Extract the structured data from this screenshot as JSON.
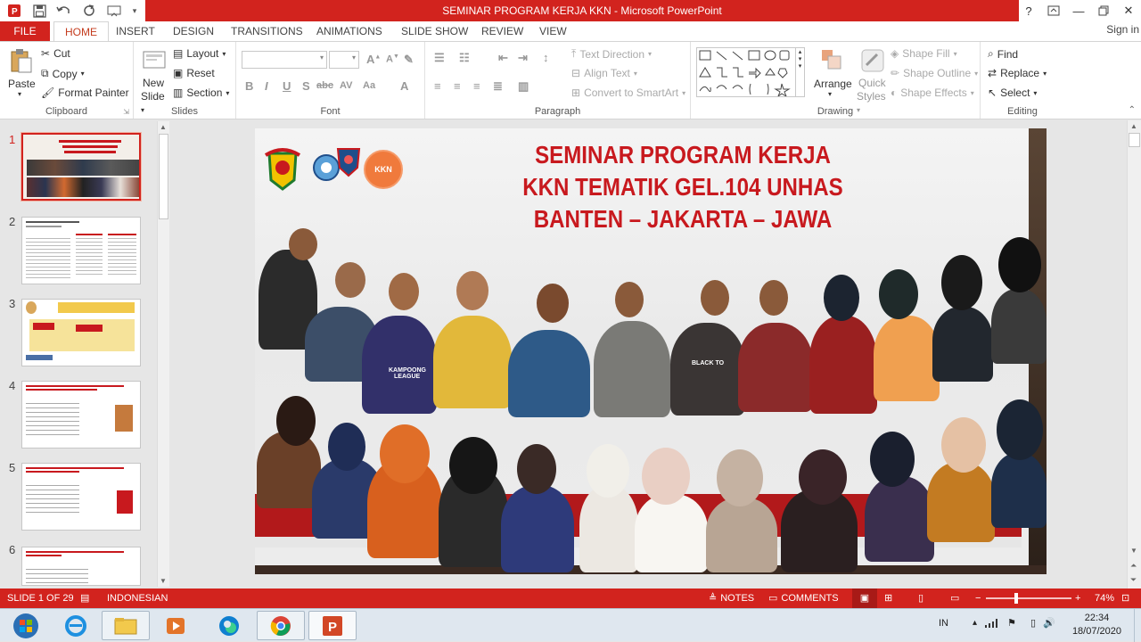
{
  "window": {
    "title": "SEMINAR PROGRAM KERJA KKN  -  Microsoft PowerPoint",
    "help_label": "?",
    "sign_in": "Sign in"
  },
  "tabs": [
    "FILE",
    "HOME",
    "INSERT",
    "DESIGN",
    "TRANSITIONS",
    "ANIMATIONS",
    "SLIDE SHOW",
    "REVIEW",
    "VIEW"
  ],
  "ribbon": {
    "clipboard": {
      "label": "Clipboard",
      "paste": "Paste",
      "cut": "Cut",
      "copy": "Copy",
      "format_painter": "Format Painter"
    },
    "slides": {
      "label": "Slides",
      "new_slide_1": "New",
      "new_slide_2": "Slide",
      "layout": "Layout",
      "reset": "Reset",
      "section": "Section"
    },
    "font": {
      "label": "Font",
      "bold": "B",
      "italic": "I",
      "underline": "U",
      "shadow": "S",
      "strike": "abc",
      "spacing": "AV",
      "case": "Aa",
      "grow": "A",
      "shrink": "A",
      "color": "A"
    },
    "paragraph": {
      "label": "Paragraph",
      "text_direction": "Text Direction",
      "align_text": "Align Text",
      "convert_smartart": "Convert to SmartArt"
    },
    "drawing": {
      "label": "Drawing",
      "arrange": "Arrange",
      "quick_styles_1": "Quick",
      "quick_styles_2": "Styles",
      "shape_fill": "Shape Fill",
      "shape_outline": "Shape Outline",
      "shape_effects": "Shape Effects"
    },
    "editing": {
      "label": "Editing",
      "find": "Find",
      "replace": "Replace",
      "select": "Select"
    }
  },
  "thumbnails": [
    {
      "num": "1",
      "active": true
    },
    {
      "num": "2",
      "active": false
    },
    {
      "num": "3",
      "active": false
    },
    {
      "num": "4",
      "active": false
    },
    {
      "num": "5",
      "active": false
    },
    {
      "num": "6",
      "active": false
    }
  ],
  "slide": {
    "title_line1": "SEMINAR PROGRAM KERJA",
    "title_line2": "KKN TEMATIK GEL.104 UNHAS",
    "title_line3": "BANTEN – JAKARTA – JAWA",
    "logo_text": "KKN",
    "shirt_text_1": "KAMPOONG",
    "shirt_text_2": "LEAGUE",
    "shirt_text_3": "BLACK TO"
  },
  "status": {
    "slide_info": "SLIDE 1 OF 29",
    "language": "INDONESIAN",
    "notes": "NOTES",
    "comments": "COMMENTS",
    "zoom": "74%",
    "zoom_level": 0.74
  },
  "taskbar": {
    "lang": "IN",
    "time": "22:34",
    "date": "18/07/2020"
  },
  "colors": {
    "accent": "#d2231e",
    "title_red": "#c8191e",
    "ribbon_bg": "#ffffff",
    "taskbar_bg": "#dfe7ef"
  }
}
